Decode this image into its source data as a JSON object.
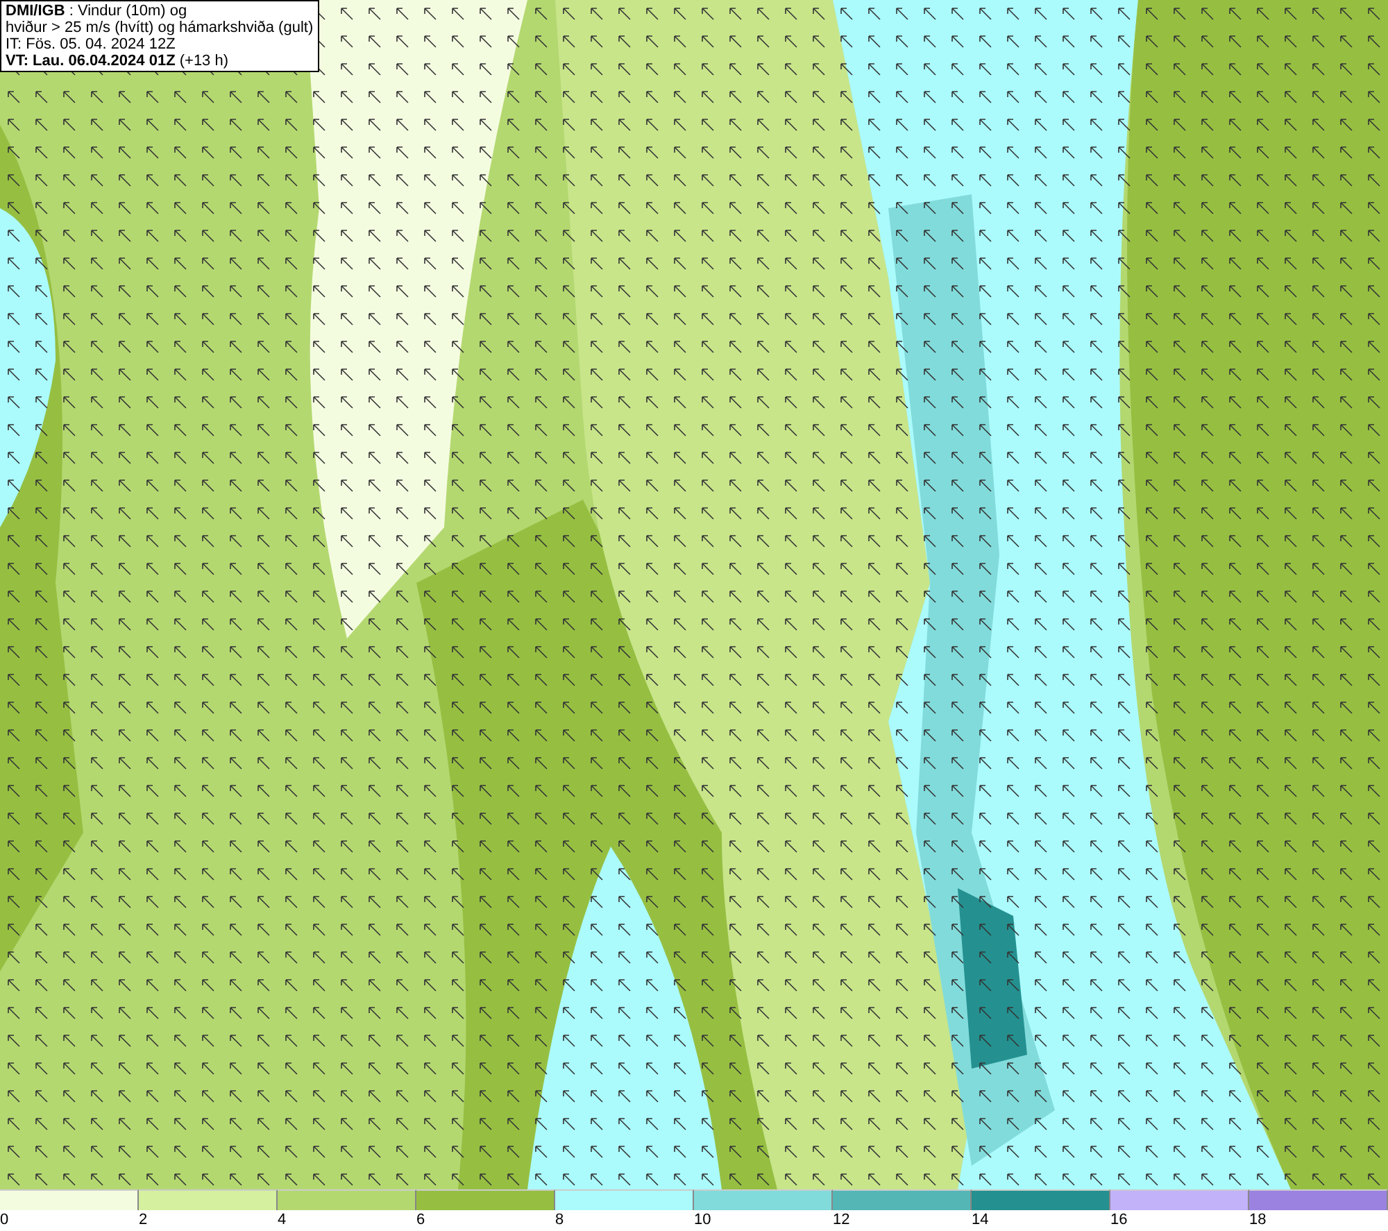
{
  "title_box": {
    "lines": [
      "**DMI/IGB** : Vindur (10m) og",
      "hviður > 25 m/s (hvítt) og hámarkshviða (gult)",
      "IT: Fös. 05. 04. 2024 12Z",
      "**VT: Lau. 06.04.2024 01Z** (+13 h)"
    ]
  },
  "legend": [
    {
      "label": "0",
      "color": "#f4fce0"
    },
    {
      "label": "2",
      "color": "#d5f09e"
    },
    {
      "label": "4",
      "color": "#b4d870"
    },
    {
      "label": "6",
      "color": "#96bf42"
    },
    {
      "label": "8",
      "color": "#abfafc"
    },
    {
      "label": "10",
      "color": "#82dbdb"
    },
    {
      "label": "12",
      "color": "#55b6b6"
    },
    {
      "label": "14",
      "color": "#249190"
    },
    {
      "label": "16",
      "color": "#c1b2fa"
    },
    {
      "label": "18",
      "color": "#9b82e0"
    }
  ]
}
